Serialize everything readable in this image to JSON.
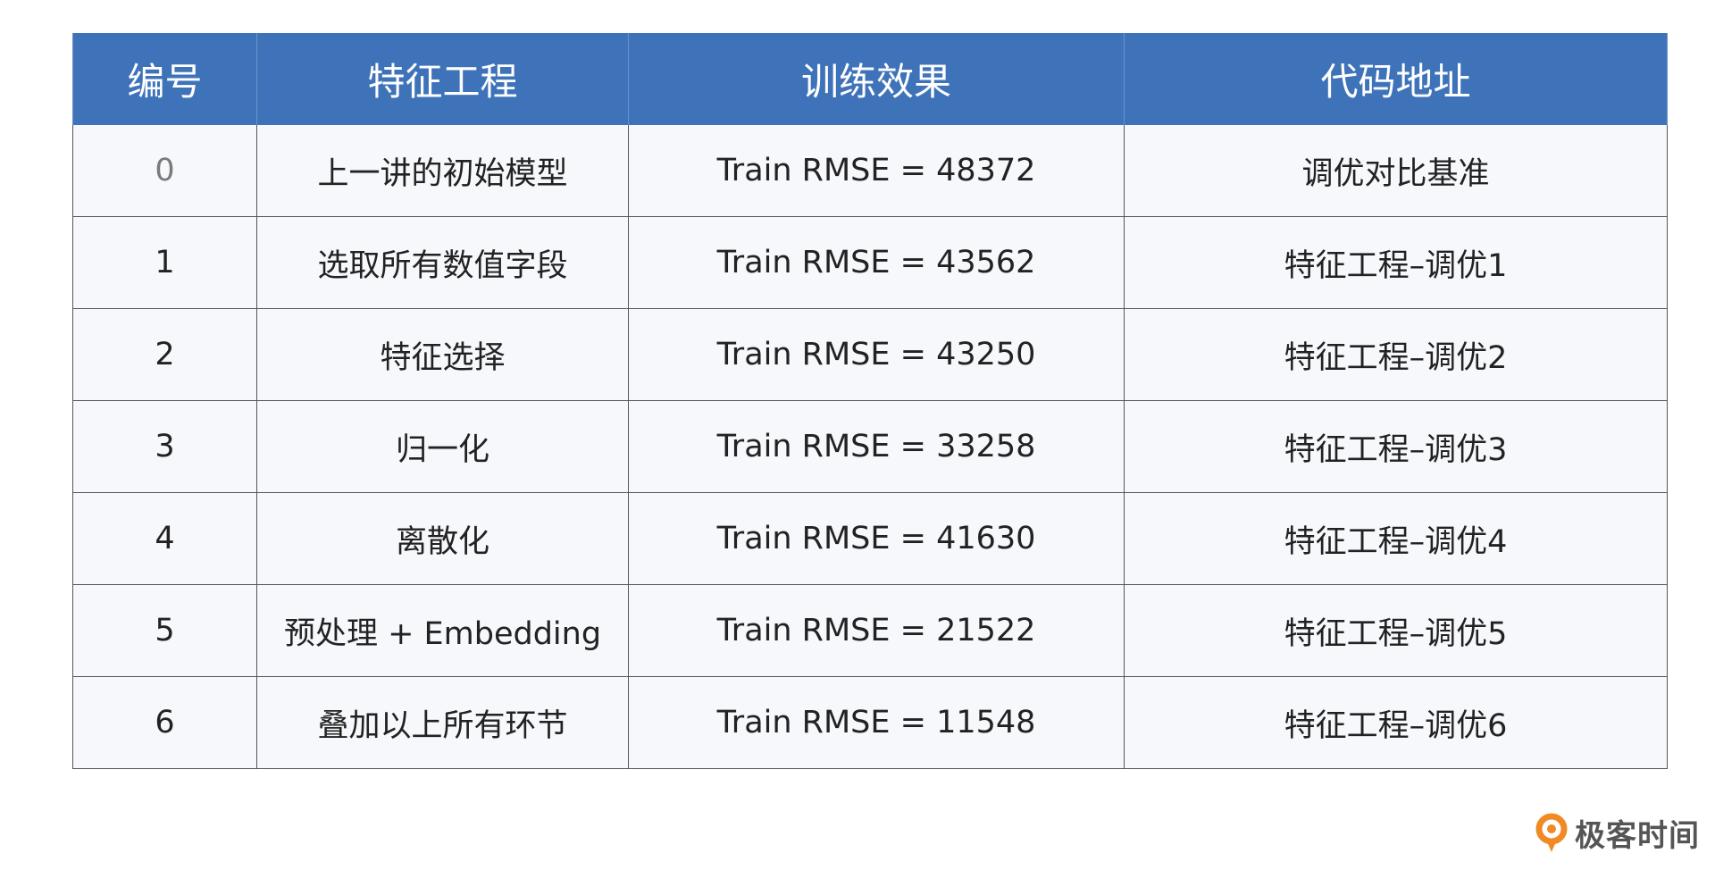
{
  "table": {
    "headers": [
      "编号",
      "特征工程",
      "训练效果",
      "代码地址"
    ],
    "rows": [
      {
        "id": "0",
        "feature": "上一讲的初始模型",
        "result": "Train RMSE = 48372",
        "code": "调优对比基准"
      },
      {
        "id": "1",
        "feature": "选取所有数值字段",
        "result": "Train RMSE = 43562",
        "code": "特征工程–调优1"
      },
      {
        "id": "2",
        "feature": "特征选择",
        "result": "Train RMSE = 43250",
        "code": "特征工程–调优2"
      },
      {
        "id": "3",
        "feature": "归一化",
        "result": "Train RMSE = 33258",
        "code": "特征工程–调优3"
      },
      {
        "id": "4",
        "feature": "离散化",
        "result": "Train RMSE = 41630",
        "code": "特征工程–调优4"
      },
      {
        "id": "5",
        "feature": "预处理 + Embedding",
        "result": "Train RMSE = 21522",
        "code": "特征工程–调优5"
      },
      {
        "id": "6",
        "feature": "叠加以上所有环节",
        "result": "Train RMSE = 11548",
        "code": "特征工程–调优6"
      }
    ]
  },
  "brand": {
    "name": "极客时间",
    "logo_icon": "geektime-logo-icon"
  },
  "colors": {
    "header_bg": "#3f73b9",
    "row_bg": "#f7f8fc",
    "logo_orange": "#f08a24"
  }
}
